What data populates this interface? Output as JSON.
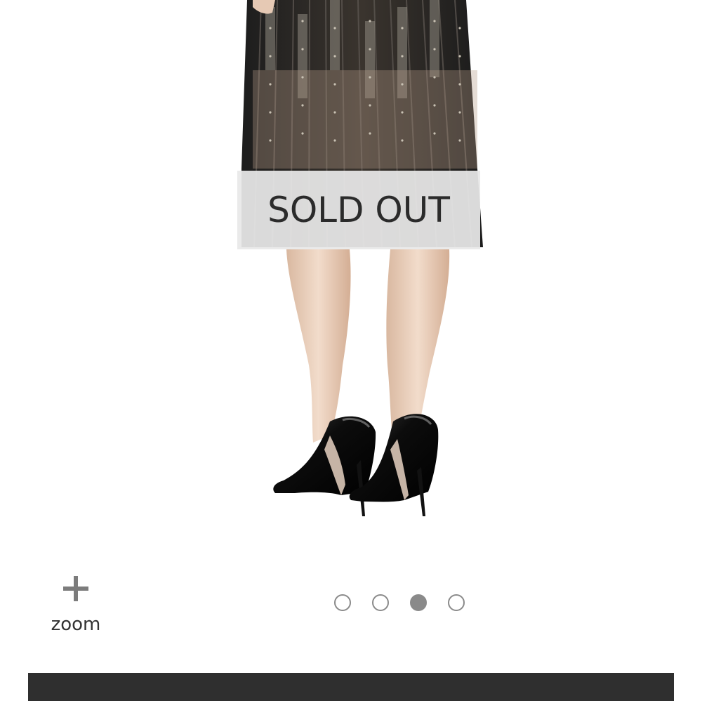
{
  "product_image": {
    "description_icon": "product-photo",
    "sold_out_label": "SOLD OUT"
  },
  "zoom": {
    "icon": "plus-icon",
    "label": "zoom"
  },
  "carousel": {
    "total": 4,
    "active_index": 2
  },
  "colors": {
    "banner_bg": "#e8e8e8",
    "dot": "#8a8a8a",
    "bottom_bar": "#2f2f2f"
  }
}
